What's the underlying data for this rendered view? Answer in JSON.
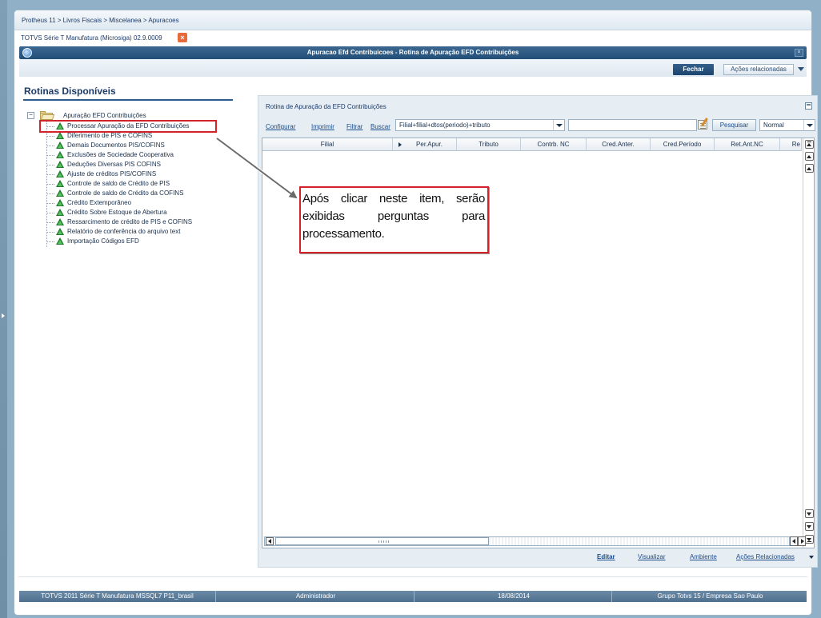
{
  "breadcrumb": "Protheus 11 > Livros Fiscais > Miscelanea > Apuracoes",
  "app_tab": {
    "label": "TOTVS Série T Manufatura (Microsiga) 02.9.0009",
    "close_glyph": "×"
  },
  "window": {
    "title": "Apuracao Efd Contribuicoes - Rotina de Apuração EFD Contribuições",
    "close_glyph": "×"
  },
  "toolbar": {
    "fechar_label": "Fechar",
    "acoes_label": "Ações relacionadas"
  },
  "left_panel": {
    "title": "Rotinas Disponíveis",
    "root": {
      "expander": "−",
      "label": "Apuração EFD Contribuições"
    },
    "items": [
      "Processar Apuração da EFD Contribuições",
      "Diferimento de PIS e COFINS",
      "Demais Documentos PIS/COFINS",
      "Exclusões de Sociedade Cooperativa",
      "Deduções Diversas PIS COFINS",
      "Ajuste de créditos PIS/COFINS",
      "Controle de saldo de Crédito de PIS",
      "Controle de saldo de Crédito da COFINS",
      "Crédito Extemporâneo",
      "Crédito Sobre Estoque de Abertura",
      "Ressarcimento de crédito de PIS e COFINS",
      "Relatório de conferência do arquivo text",
      "Importação Códigos EFD"
    ]
  },
  "callout_text": "Após clicar neste item, serão exibidas perguntas para processamento.",
  "right_panel": {
    "title": "Rotina de Apuração da EFD Contribuições",
    "links": {
      "configurar": "Configurar",
      "imprimir": "Imprimir",
      "filtrar": "Filtrar",
      "buscar": "Buscar"
    },
    "order_select_value": "Filial+filial+dtos(periodo)+tributo",
    "search_value": "",
    "pesquisar_label": "Pesquisar",
    "mode_select_value": "Normal",
    "columns": [
      "Filial",
      "Per.Apur.",
      "Tributo",
      "Contrb. NC",
      "Cred.Anter.",
      "Cred.Período",
      "Ret.Ant.NC",
      "Re"
    ],
    "footer_links": {
      "editar": "Editar",
      "visualizar": "Visualizar",
      "ambiente": "Ambiente",
      "acoes": "Ações Relacionadas"
    }
  },
  "status_bar": {
    "environment": "TOTVS 2011 Série T Manufatura MSSQL7 P11_brasil",
    "user": "Administrador",
    "date": "18/08/2014",
    "company": "Grupo Totvs 15 / Empresa Sao Paulo"
  },
  "colors": {
    "highlight_border": "#d2232a",
    "title_bar": "#224f78",
    "status_bar": "#5a7a99",
    "tree_triangle": "#1e7a2a"
  }
}
